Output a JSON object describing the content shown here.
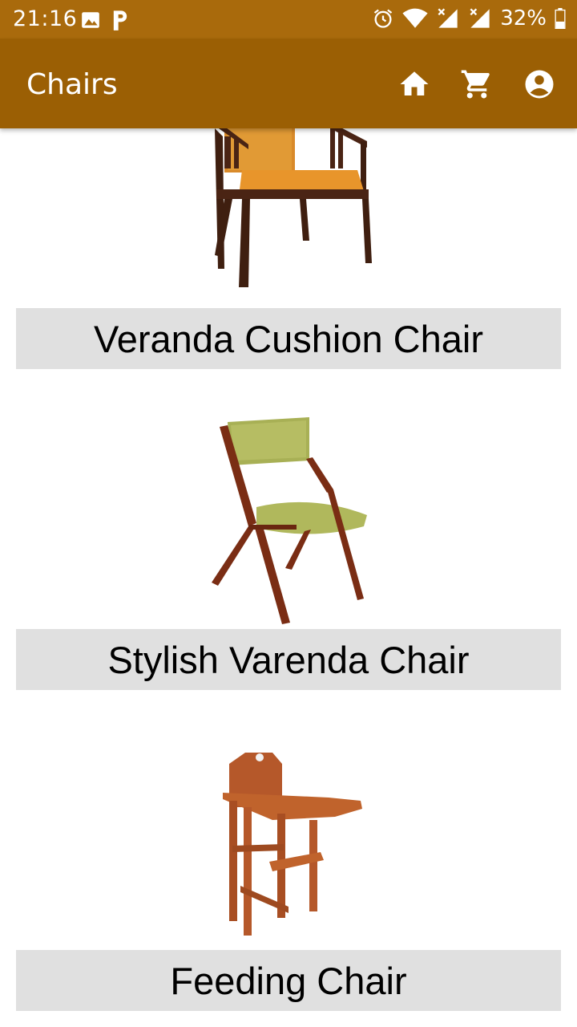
{
  "status_bar": {
    "time": "21:16",
    "battery": "32%",
    "icons": [
      "image-icon",
      "parking-icon",
      "alarm-icon",
      "wifi-icon",
      "signal-icon",
      "signal-icon",
      "battery-icon"
    ]
  },
  "app_bar": {
    "title": "Chairs",
    "actions": [
      "home-icon",
      "cart-icon",
      "account-icon"
    ]
  },
  "products": [
    {
      "name": "Veranda Cushion Chair",
      "image": "veranda-cushion-chair-image"
    },
    {
      "name": "Stylish Varenda Chair",
      "image": "stylish-varenda-chair-image"
    },
    {
      "name": "Feeding Chair",
      "image": "feeding-chair-image"
    }
  ],
  "colors": {
    "status_bar": "#a96a0c",
    "app_bar": "#9b5f04",
    "name_bar": "#e0e0e0"
  }
}
